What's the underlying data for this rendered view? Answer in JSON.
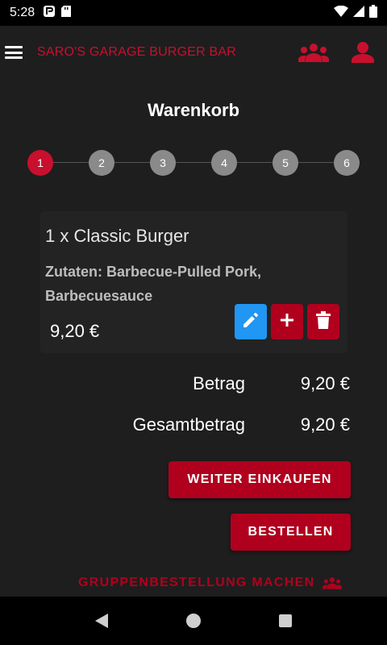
{
  "status": {
    "time": "5:28"
  },
  "appbar": {
    "title": "SARO'S GARAGE BURGER BAR"
  },
  "page": {
    "title": "Warenkorb"
  },
  "stepper": {
    "steps": [
      "1",
      "2",
      "3",
      "4",
      "5",
      "6"
    ],
    "active": 1
  },
  "cart": {
    "items": [
      {
        "name": "1 x Classic Burger",
        "ingredients": "Zutaten: Barbecue-Pulled Pork, Barbecuesauce",
        "price": "9,20 €"
      }
    ]
  },
  "summary": {
    "amount_label": "Betrag",
    "amount_value": "9,20 €",
    "total_label": "Gesamtbetrag",
    "total_value": "9,20 €"
  },
  "buttons": {
    "continue_shopping": "WEITER EINKAUFEN",
    "order": "BESTELLEN",
    "group_order": "GRUPPENBESTELLUNG MACHEN"
  },
  "icons": {
    "menu": "menu-icon",
    "group": "group-icon",
    "account": "person-icon",
    "edit": "pencil-icon",
    "add": "plus-icon",
    "delete": "trash-icon"
  },
  "colors": {
    "brand_red": "#c8102e",
    "button_red": "#b0001e",
    "edit_blue": "#2196f3",
    "background": "#1e1e1e",
    "card": "#232323"
  }
}
